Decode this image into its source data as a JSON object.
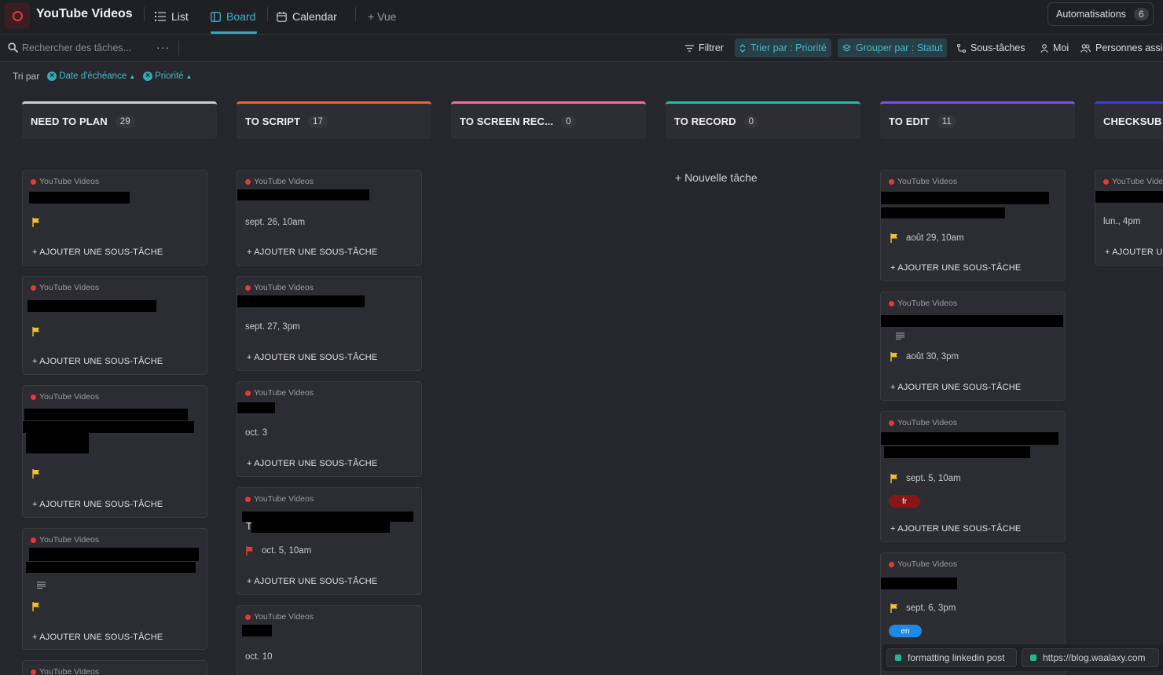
{
  "header": {
    "app_title": "YouTube Videos",
    "views": [
      "List",
      "Board",
      "Calendar"
    ],
    "add_view": "+ Vue",
    "automations_label": "Automatisations",
    "automations_count": "6"
  },
  "toolbar": {
    "search_placeholder": "Rechercher des tâches...",
    "filter": "Filtrer",
    "sort": "Trier par : Priorité",
    "group": "Grouper par : Statut",
    "subtasks": "Sous-tâches",
    "me": "Moi",
    "assignees": "Personnes assignées"
  },
  "sort_bar": {
    "label": "Tri par",
    "chips": [
      "Date d'échéance",
      "Priorité"
    ]
  },
  "card_common": {
    "source": "YouTube Videos",
    "add_subtask": "+ AJOUTER UNE SOUS-TÂCHE"
  },
  "columns": [
    {
      "name": "NEED TO PLAN",
      "count": "29",
      "color": "#d0d0d4"
    },
    {
      "name": "TO SCRIPT",
      "count": "17",
      "color": "#e8663b"
    },
    {
      "name": "TO SCREEN REC...",
      "count": "0",
      "color": "#ef6fa4"
    },
    {
      "name": "TO RECORD",
      "count": "0",
      "color": "#2bb7a1"
    },
    {
      "name": "TO EDIT",
      "count": "11",
      "color": "#7b52e8"
    },
    {
      "name": "CHECKSUB",
      "count": "",
      "color": "#3c3fd6"
    }
  ],
  "cards": {
    "script": [
      {
        "date": "sept. 26, 10am"
      },
      {
        "date": "sept. 27, 3pm"
      },
      {
        "date": "oct. 3"
      },
      {
        "date": "oct. 5, 10am"
      },
      {
        "date": "oct. 10"
      }
    ],
    "edit": [
      {
        "date": "août 29, 10am"
      },
      {
        "date": "août 30, 3pm"
      },
      {
        "date": "sept. 5, 10am",
        "tag": "fr"
      },
      {
        "date": "sept. 6, 3pm",
        "tag": "en"
      }
    ],
    "checksub": [
      {
        "source": "YouTube Vide",
        "date": "lun., 4pm",
        "add": "+ AJOUTER UI"
      }
    ],
    "script_visible_char": "T"
  },
  "new_task": "+ Nouvelle tâche",
  "links": [
    "formatting linkedin post",
    "https://blog.waalaxy.com"
  ],
  "colors": {
    "accent": "#3fb4c7",
    "flag_yellow": "#f2c12e",
    "flag_red": "#e5383b",
    "tag_fr": "#8b1414",
    "tag_en": "#1e88e5"
  }
}
